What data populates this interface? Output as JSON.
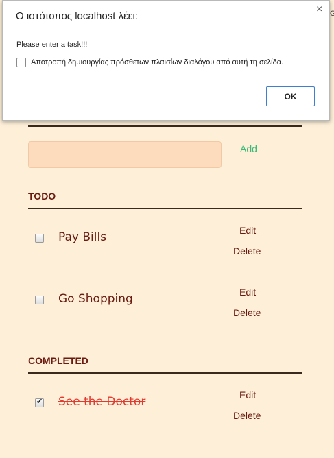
{
  "dialog": {
    "title": "Ο ιστότοπος localhost λέει:",
    "message": "Please enter a task!!!",
    "suppress_label": "Αποτροπή δημιουργίας πρόσθετων πλαισίων διαλόγου από αυτή τη σελίδα.",
    "ok_label": "OK",
    "close_symbol": "×"
  },
  "form": {
    "add_label": "Add",
    "input_value": ""
  },
  "todo": {
    "title": "TODO",
    "items": [
      {
        "label": "Pay Bills",
        "edit": "Edit",
        "delete": "Delete",
        "checked": false
      },
      {
        "label": "Go Shopping",
        "edit": "Edit",
        "delete": "Delete",
        "checked": false
      }
    ]
  },
  "completed": {
    "title": "COMPLETED",
    "items": [
      {
        "label": "See the Doctor",
        "edit": "Edit",
        "delete": "Delete",
        "checked": true
      }
    ]
  },
  "edge_glyph": "G",
  "colors": {
    "background": "#fdefd8",
    "input_bg": "#fddbbd",
    "add_link": "#3cb878",
    "text": "#6b1a10",
    "completed_text": "#e23a2f",
    "ok_border": "#3e7fd0"
  }
}
